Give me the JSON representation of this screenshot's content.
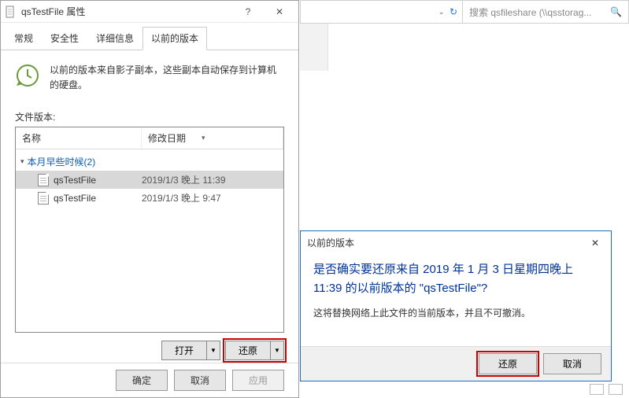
{
  "props": {
    "title": "qsTestFile 属性",
    "tabs": [
      "常规",
      "安全性",
      "详细信息",
      "以前的版本"
    ],
    "active_tab": 3,
    "info": "以前的版本来自影子副本，这些副本自动保存到计算机的硬盘。",
    "section_label": "文件版本:",
    "columns": {
      "name": "名称",
      "date": "修改日期"
    },
    "group": "本月早些时候(2)",
    "files": [
      {
        "name": "qsTestFile",
        "date": "2019/1/3 晚上 11:39",
        "selected": true
      },
      {
        "name": "qsTestFile",
        "date": "2019/1/3 晚上 9:47",
        "selected": false
      }
    ],
    "open_btn": "打开",
    "restore_btn": "还原",
    "ok": "确定",
    "cancel": "取消",
    "apply": "应用"
  },
  "explorer": {
    "search_placeholder": "搜索 qsfileshare (\\\\qsstorag..."
  },
  "confirm": {
    "title": "以前的版本",
    "heading": "是否确实要还原来自 2019 年 1 月 3 日星期四晚上 11:39 的以前版本的 \"qsTestFile\"?",
    "text": "这将替换网络上此文件的当前版本，并且不可撤消。",
    "restore": "还原",
    "cancel": "取消"
  }
}
